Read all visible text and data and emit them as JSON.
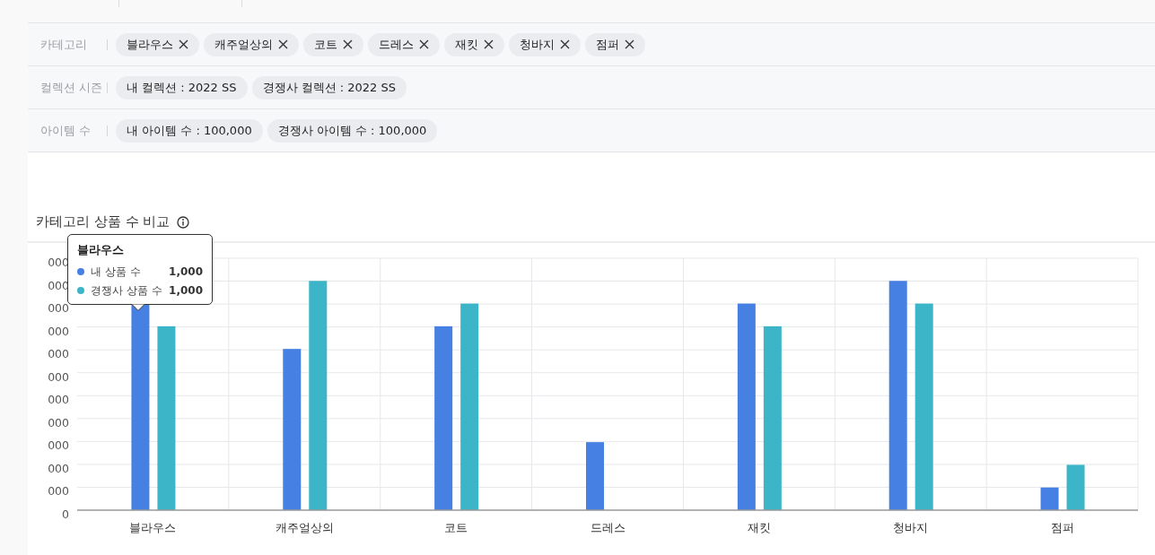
{
  "filters": [
    {
      "label": "카테고리",
      "chips": [
        {
          "text": "블라우스",
          "removable": true
        },
        {
          "text": "캐주얼상의",
          "removable": true
        },
        {
          "text": "코트",
          "removable": true
        },
        {
          "text": "드레스",
          "removable": true
        },
        {
          "text": "재킷",
          "removable": true
        },
        {
          "text": "청바지",
          "removable": true
        },
        {
          "text": "점퍼",
          "removable": true
        }
      ]
    },
    {
      "label": "컬렉션 시즌",
      "chips": [
        {
          "text": "내 컬렉션 : 2022 SS",
          "removable": false
        },
        {
          "text": "경쟁사 컬렉션 : 2022 SS",
          "removable": false
        }
      ]
    },
    {
      "label": "아이템 수",
      "chips": [
        {
          "text": "내 아이템 수 : 100,000",
          "removable": false
        },
        {
          "text": "경쟁사 아이템 수 : 100,000",
          "removable": false
        }
      ]
    }
  ],
  "chart_section": {
    "title": "카테고리 상품 수 비교",
    "tooltip": {
      "title": "블라우스",
      "items": [
        {
          "name": "내 상품 수",
          "value": "1,000",
          "color": "#4680e3"
        },
        {
          "name": "경쟁사 상품 수",
          "value": "1,000",
          "color": "#3db5c8"
        }
      ]
    },
    "x_axis_labels": [
      "블라우스",
      "캐주얼상의",
      "코트",
      "드레스",
      "재킷",
      "청바지",
      "점퍼"
    ],
    "y_axis_labels": [
      "000",
      "000",
      "000",
      "000",
      "000",
      "000",
      "000",
      "000",
      "000",
      "000",
      "000",
      "0"
    ]
  }
}
